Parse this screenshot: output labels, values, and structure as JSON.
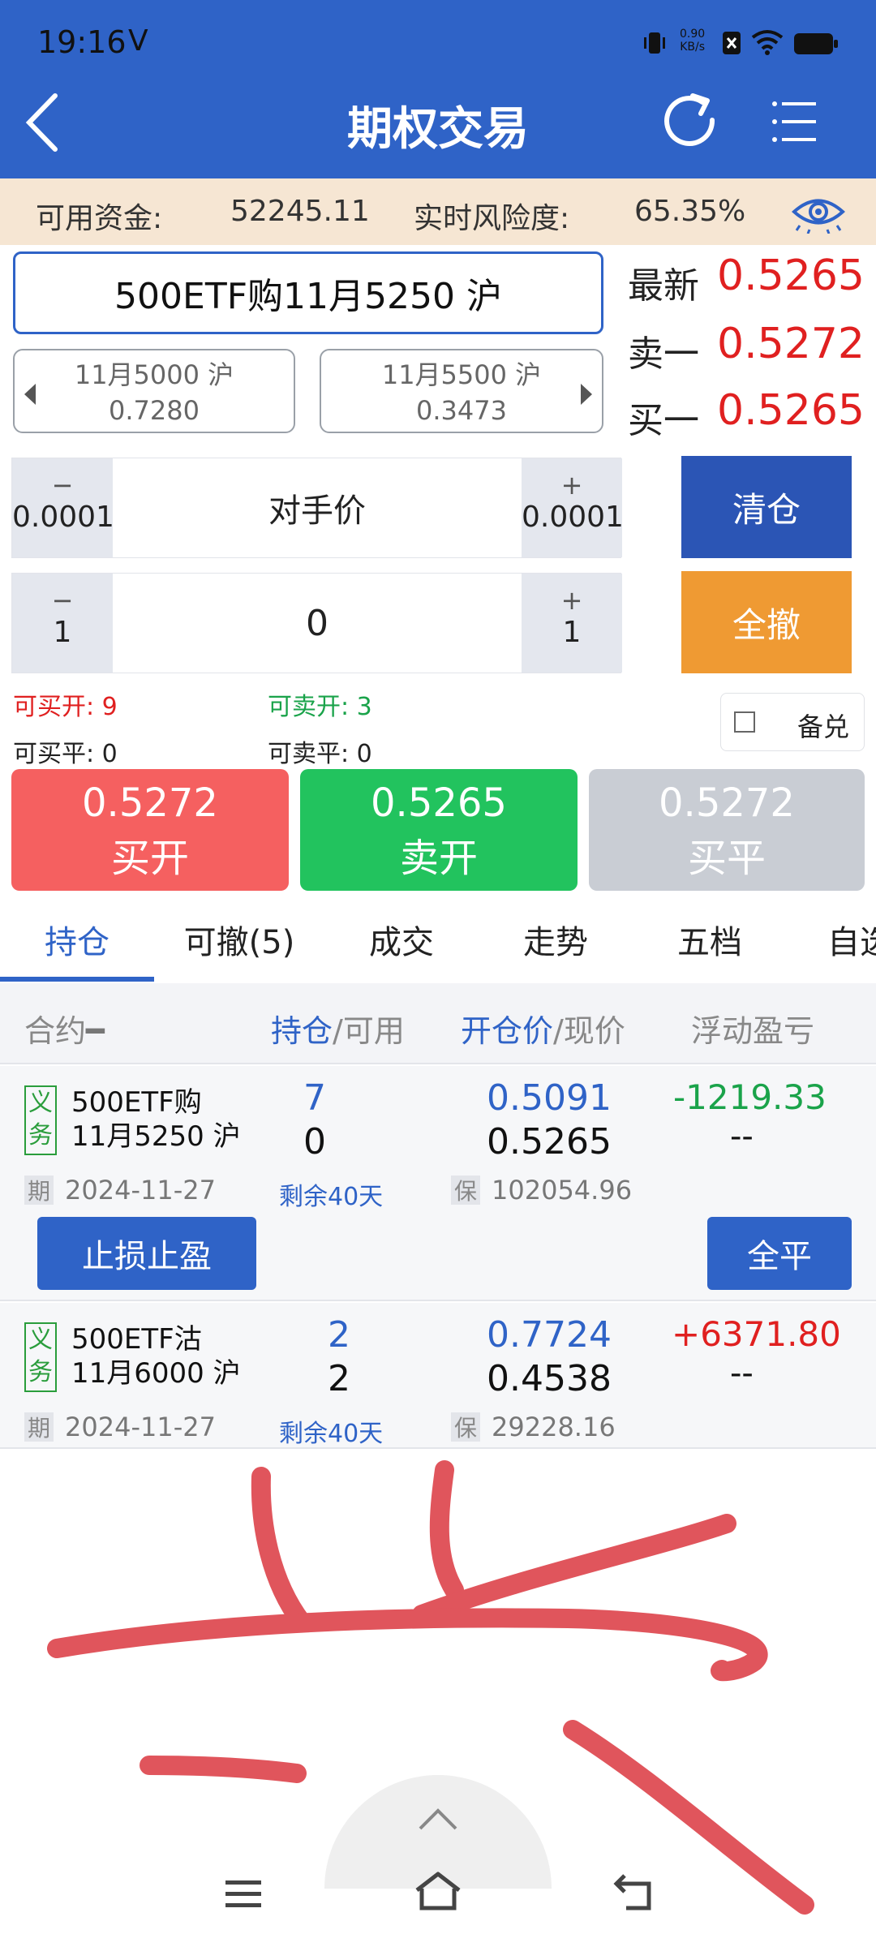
{
  "status": {
    "time": "19:16",
    "carrier_icon": "V",
    "net_speed_top": "0.90",
    "net_speed_bottom": "KB/s"
  },
  "header": {
    "title": "期权交易"
  },
  "funds": {
    "avail_label": "可用资金:",
    "avail_value": "52245.11",
    "risk_label": "实时风险度:",
    "risk_value": "65.35%"
  },
  "contract": {
    "name": "500ETF购11月5250 沪"
  },
  "prev_contract": {
    "name": "11月5000 沪",
    "price": "0.7280"
  },
  "next_contract": {
    "name": "11月5500 沪",
    "price": "0.3473"
  },
  "quote": {
    "latest_label": "最新",
    "latest": "0.5265",
    "ask_label": "卖一",
    "ask": "0.5272",
    "bid_label": "买一",
    "bid": "0.5265"
  },
  "price_stepper": {
    "minus_sign": "−",
    "minus_step": "0.0001",
    "value": "对手价",
    "plus_sign": "+",
    "plus_step": "0.0001"
  },
  "qty_stepper": {
    "minus_sign": "−",
    "minus_step": "1",
    "value": "0",
    "plus_sign": "+",
    "plus_step": "1"
  },
  "actions": {
    "clear": "清仓",
    "cancel_all": "全撤"
  },
  "availability": {
    "buy_open": "可买开: 9",
    "sell_open": "可卖开: 3",
    "buy_close": "可买平: 0",
    "sell_close": "可卖平: 0",
    "covered": "备兑"
  },
  "orders": {
    "buy_open": {
      "price": "0.5272",
      "label": "买开"
    },
    "sell_open": {
      "price": "0.5265",
      "label": "卖开"
    },
    "buy_close": {
      "price": "0.5272",
      "label": "买平"
    }
  },
  "tabs": [
    "持仓",
    "可撤(5)",
    "成交",
    "走势",
    "五档",
    "自选"
  ],
  "columns": {
    "contract": "合约",
    "contract_mark": "━",
    "pos_a": "持仓",
    "pos_b": "/可用",
    "price_a": "开仓价",
    "price_b": "/现价",
    "pnl": "浮动盈亏"
  },
  "positions": [
    {
      "tag": "义务",
      "name1": "500ETF购",
      "name2": "11月5250 沪",
      "hold": "7",
      "avail": "0",
      "open_price": "0.5091",
      "cur_price": "0.5265",
      "pnl": "-1219.33",
      "pnl2": "--",
      "expiry_tag": "期",
      "expiry": "2024-11-27",
      "remain": "剩余40天",
      "margin_tag": "保",
      "margin": "102054.96",
      "stop_btn": "止损止盈",
      "close_btn": "全平"
    },
    {
      "tag": "义务",
      "name1": "500ETF沽",
      "name2": "11月6000 沪",
      "hold": "2",
      "avail": "2",
      "open_price": "0.7724",
      "cur_price": "0.4538",
      "pnl": "+6371.80",
      "pnl2": "--",
      "expiry_tag": "期",
      "expiry": "2024-11-27",
      "remain": "剩余40天",
      "margin_tag": "保",
      "margin": "29228.16"
    }
  ],
  "colors": {
    "primary": "#2f63c7",
    "red": "#e02020",
    "green": "#1aa34a",
    "orange": "#ef9a33",
    "buy": "#f56060",
    "sell": "#22c35e",
    "disabled": "#c9cdd4",
    "scribble": "#e0555c"
  }
}
